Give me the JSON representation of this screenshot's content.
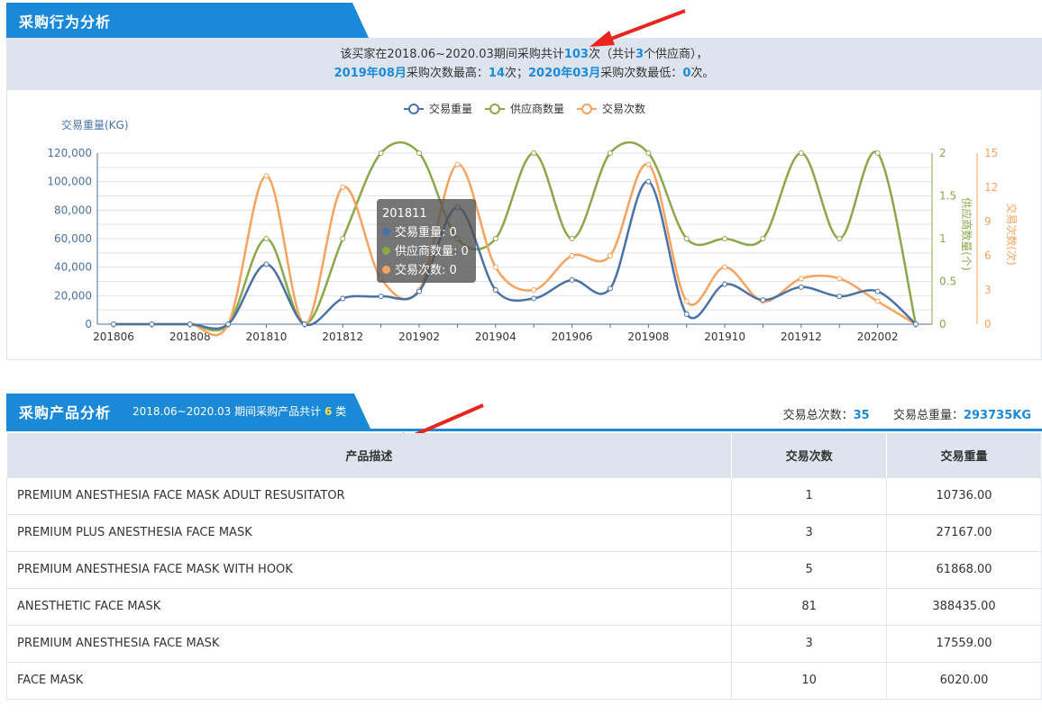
{
  "behavior": {
    "title": "采购行为分析",
    "summary_line1": {
      "pre": "该买家在2018.06~2020.03期间采购共计",
      "count": "103",
      "mid": "次（共计",
      "suppliers": "3",
      "post": "个供应商），"
    },
    "summary_line2": {
      "max_month": "2019年08月",
      "max_text": "采购次数最高：",
      "max_count": "14",
      "sep": "次；",
      "min_month": "2020年03月",
      "min_text": "采购次数最低：",
      "min_count": "0",
      "end": "次。"
    }
  },
  "chart_data": {
    "type": "line",
    "legend": [
      "交易重量",
      "供应商数量",
      "交易次数"
    ],
    "legend_position": "top-center",
    "ylabel_left": "交易重量(KG)",
    "ylabel_right1": "供应商数量(个)",
    "ylabel_right2": "交易次数(次)",
    "x": [
      "201806",
      "201807",
      "201808",
      "201809",
      "201810",
      "201811",
      "201812",
      "201901",
      "201902",
      "201903",
      "201904",
      "201905",
      "201906",
      "201907",
      "201908",
      "201909",
      "201910",
      "201911",
      "201912",
      "202001",
      "202002",
      "202003"
    ],
    "x_tick_labels": [
      "201806",
      "201808",
      "201810",
      "201812",
      "201902",
      "201904",
      "201906",
      "201908",
      "201910",
      "201912",
      "202002"
    ],
    "y_left_ticks": [
      "0",
      "20,000",
      "40,000",
      "60,000",
      "80,000",
      "100,000",
      "120,000"
    ],
    "y_right1_ticks": [
      "0",
      "0.5",
      "1",
      "1.5",
      "2"
    ],
    "y_right2_ticks": [
      "0",
      "3",
      "6",
      "9",
      "12",
      "15"
    ],
    "ylim_left": [
      0,
      120000
    ],
    "ylim_right1": [
      0,
      2
    ],
    "ylim_right2": [
      0,
      15
    ],
    "colors": {
      "weight": "#4a72a4",
      "suppliers": "#8aa84a",
      "transactions": "#f5a35f"
    },
    "series": [
      {
        "name": "交易重量",
        "axis": "left",
        "values": [
          0,
          0,
          0,
          0,
          42000,
          0,
          18000,
          19500,
          23000,
          82000,
          24000,
          18000,
          31000,
          25000,
          100000,
          7000,
          28000,
          17000,
          26000,
          19500,
          23000,
          0
        ]
      },
      {
        "name": "供应商数量",
        "axis": "right1",
        "values": [
          0,
          0,
          0,
          0,
          1,
          0,
          1,
          2,
          2,
          1,
          1,
          2,
          1,
          2,
          2,
          1,
          1,
          1,
          2,
          1,
          2,
          0
        ]
      },
      {
        "name": "交易次数",
        "axis": "right2",
        "values": [
          0,
          0,
          0,
          0,
          13,
          0,
          12,
          4,
          3,
          14,
          5,
          3,
          6,
          6,
          14,
          2,
          5,
          2,
          4,
          4,
          2,
          0
        ]
      }
    ],
    "tooltip": {
      "title": "201811",
      "rows": [
        "交易重量: 0",
        "供应商数量: 0",
        "交易次数: 0"
      ]
    }
  },
  "products": {
    "title": "采购产品分析",
    "sub_pre": "2018.06~2020.03 期间采购产品共计",
    "sub_count": "6",
    "sub_post": "类",
    "total_count_label": "交易总次数：",
    "total_count": "35",
    "total_weight_label": "交易总重量：",
    "total_weight": "293735KG",
    "columns": [
      "产品描述",
      "交易次数",
      "交易重量"
    ],
    "rows": [
      [
        "PREMIUM ANESTHESIA FACE MASK ADULT RESUSITATOR",
        "1",
        "10736.00"
      ],
      [
        "PREMIUM PLUS ANESTHESIA FACE MASK",
        "3",
        "27167.00"
      ],
      [
        "PREMIUM ANESTHESIA FACE MASK WITH HOOK",
        "5",
        "61868.00"
      ],
      [
        "ANESTHETIC FACE MASK",
        "81",
        "388435.00"
      ],
      [
        "PREMIUM ANESTHESIA FACE MASK",
        "3",
        "17559.00"
      ],
      [
        "FACE MASK",
        "10",
        "6020.00"
      ]
    ]
  }
}
